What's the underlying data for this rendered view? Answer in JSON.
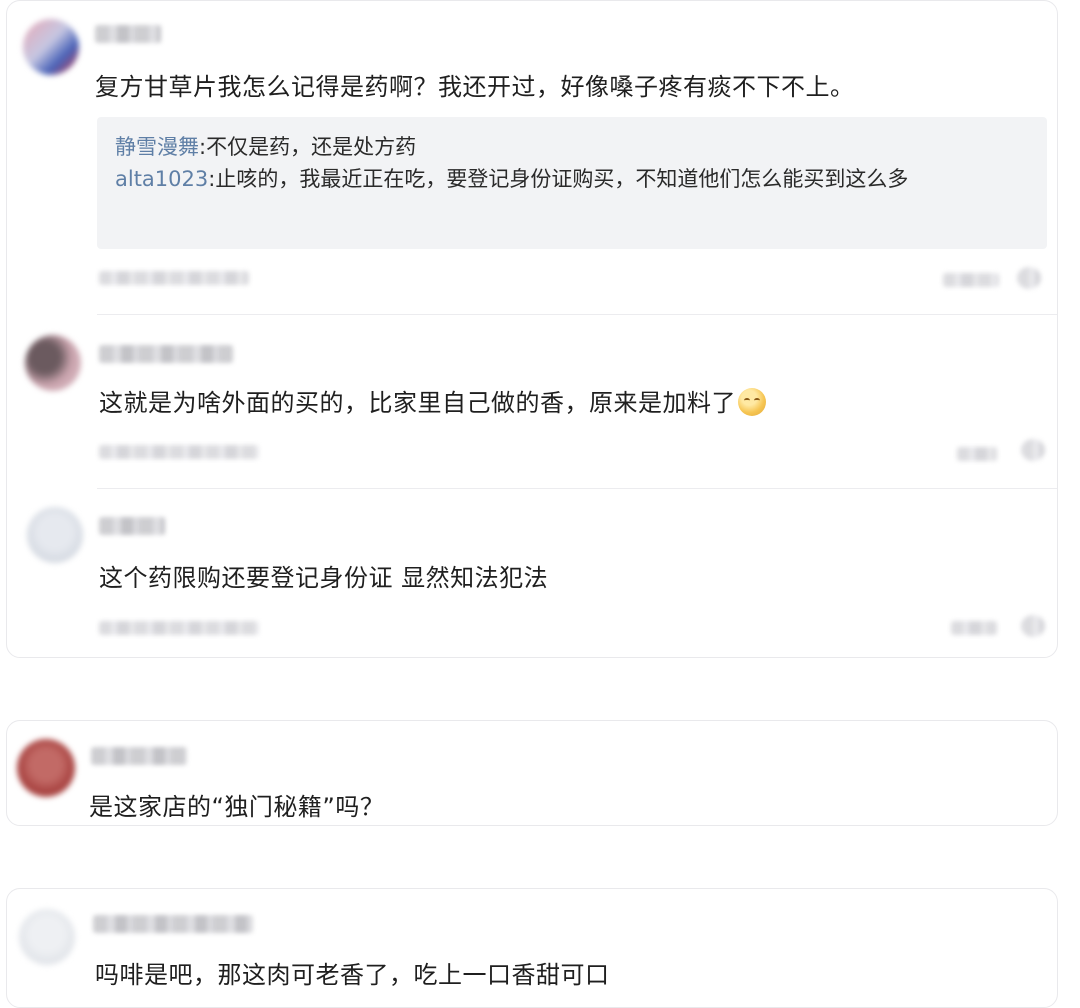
{
  "card1": {
    "comments": [
      {
        "text": "复方甘草片我怎么记得是药啊？我还开过，好像嗓子疼有痰不下不上。",
        "replies": [
          {
            "user": "静雪漫舞",
            "sep": ":",
            "text": "不仅是药，还是处方药"
          },
          {
            "user": "alta1023",
            "sep": ":",
            "text": "止咳的，我最近正在吃，要登记身份证购买，不知道他们怎么能买到这么多"
          }
        ]
      },
      {
        "text": "这就是为啥外面的买的，比家里自己做的香，原来是加料了",
        "emoji": "smirk-face-emoji"
      },
      {
        "text": "这个药限购还要登记身份证 显然知法犯法"
      }
    ]
  },
  "card2": {
    "text": "是这家店的“独门秘籍”吗？"
  },
  "card3": {
    "text": "吗啡是吧，那这肉可老香了，吃上一口香甜可口"
  },
  "colors": {
    "username": "#5f7fa6",
    "quote_bg": "#f2f3f5",
    "border": "#e9e9ec"
  }
}
